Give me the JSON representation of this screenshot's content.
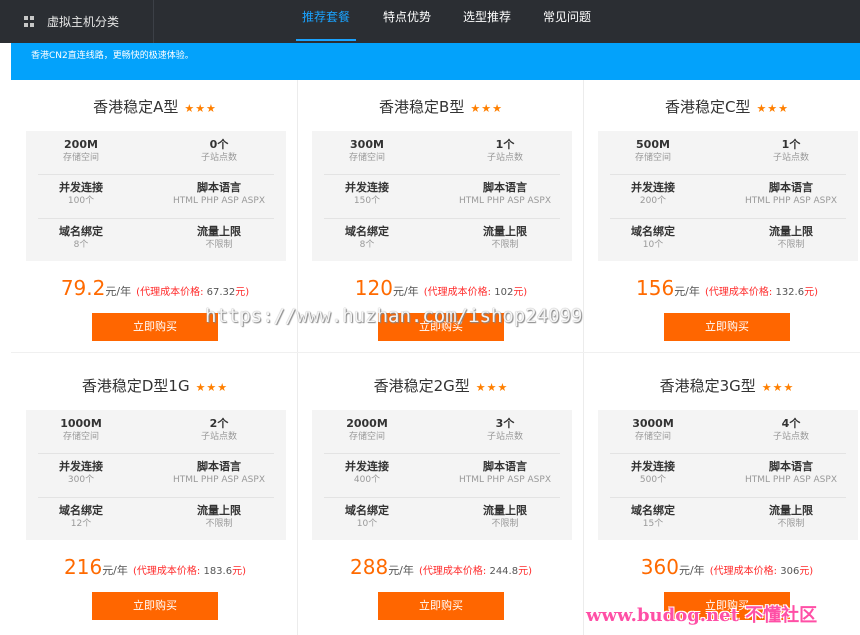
{
  "header": {
    "category_label": "虚拟主机分类",
    "nav": [
      {
        "label": "推荐套餐",
        "active": true
      },
      {
        "label": "特点优势",
        "active": false
      },
      {
        "label": "选型推荐",
        "active": false
      },
      {
        "label": "常见问题",
        "active": false
      }
    ]
  },
  "notice": "香港CN2直连线路，更畅快的极速体验。",
  "colors": {
    "accent": "#03a2fb",
    "nav_active": "#1aa3ff",
    "price": "#ff6a00",
    "button": "#ff6600",
    "stars": "#ff7f00",
    "agent_price": "#ff2a2a"
  },
  "labels": {
    "storage": "存储空间",
    "sites": "子站点数",
    "concurrency": "并发连接",
    "language": "脚本语言",
    "domains": "域名绑定",
    "traffic": "流量上限",
    "unit": "元/年",
    "agent_prefix": "(代理成本价格: ",
    "agent_suffix": "元)",
    "buy": "立即购买",
    "stars": "★★★"
  },
  "plans": [
    {
      "name": "香港稳定A型",
      "storage": "200M",
      "sites": "0个",
      "concurrency": "100个",
      "language": "HTML PHP ASP ASPX",
      "domains": "8个",
      "traffic": "不限制",
      "price": "79.2",
      "agent_price": "67.32"
    },
    {
      "name": "香港稳定B型",
      "storage": "300M",
      "sites": "1个",
      "concurrency": "150个",
      "language": "HTML PHP ASP ASPX",
      "domains": "8个",
      "traffic": "不限制",
      "price": "120",
      "agent_price": "102"
    },
    {
      "name": "香港稳定C型",
      "storage": "500M",
      "sites": "1个",
      "concurrency": "200个",
      "language": "HTML PHP ASP ASPX",
      "domains": "10个",
      "traffic": "不限制",
      "price": "156",
      "agent_price": "132.6"
    },
    {
      "name": "香港稳定D型1G",
      "storage": "1000M",
      "sites": "2个",
      "concurrency": "300个",
      "language": "HTML PHP ASP ASPX",
      "domains": "12个",
      "traffic": "不限制",
      "price": "216",
      "agent_price": "183.6"
    },
    {
      "name": "香港稳定2G型",
      "storage": "2000M",
      "sites": "3个",
      "concurrency": "400个",
      "language": "HTML PHP ASP ASPX",
      "domains": "10个",
      "traffic": "不限制",
      "price": "288",
      "agent_price": "244.8"
    },
    {
      "name": "香港稳定3G型",
      "storage": "3000M",
      "sites": "4个",
      "concurrency": "500个",
      "language": "HTML PHP ASP ASPX",
      "domains": "15个",
      "traffic": "不限制",
      "price": "360",
      "agent_price": "306"
    }
  ],
  "watermarks": {
    "center": "https://www.huzhan.com/ishop24099",
    "bottom": "www.budog.net 不懂社区"
  }
}
